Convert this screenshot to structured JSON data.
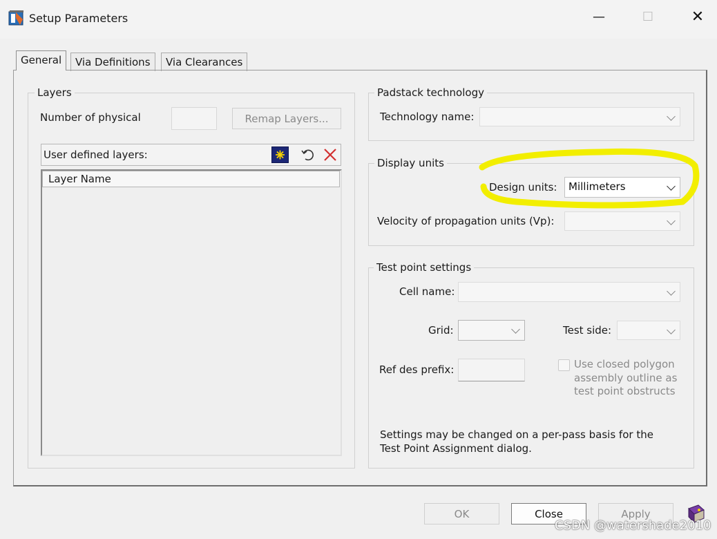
{
  "window": {
    "title": "Setup Parameters"
  },
  "tabs": [
    {
      "label": "General",
      "active": true
    },
    {
      "label": "Via Definitions",
      "active": false
    },
    {
      "label": "Via Clearances",
      "active": false
    }
  ],
  "layers": {
    "group_title": "Layers",
    "physical_label": "Number of physical",
    "physical_value": "",
    "remap_button": "Remap Layers...",
    "user_defined_label": "User defined layers:",
    "column_header": "Layer Name",
    "rows": []
  },
  "padstack": {
    "group_title": "Padstack technology",
    "tech_label": "Technology name:",
    "tech_value": ""
  },
  "display_units": {
    "group_title": "Display units",
    "design_label": "Design units:",
    "design_value": "Millimeters",
    "velocity_label": "Velocity of propagation units (Vp):",
    "velocity_value": ""
  },
  "test_point": {
    "group_title": "Test point settings",
    "cell_label": "Cell name:",
    "cell_value": "",
    "grid_label": "Grid:",
    "grid_value": "",
    "side_label": "Test side:",
    "side_value": "",
    "refdes_label": "Ref des prefix:",
    "refdes_value": "",
    "checkbox_label_1": "Use closed polygon",
    "checkbox_label_2": "assembly outline as",
    "checkbox_label_3": "test point obstructs",
    "checkbox_checked": false,
    "note_line_1": "Settings may be changed on a per-pass basis for the",
    "note_line_2": "Test Point Assignment dialog."
  },
  "footer": {
    "ok": "OK",
    "close": "Close",
    "apply": "Apply"
  },
  "icons": {
    "app": "app-icon",
    "minimize": "minimize-icon",
    "maximize": "maximize-icon",
    "close": "close-icon",
    "new_layer": "new-layer-icon",
    "undo": "undo-icon",
    "delete": "delete-icon",
    "help": "help-book-icon"
  },
  "colors": {
    "highlight": "#f2ee00",
    "new_layer_bg": "#1c2775",
    "delete": "#d23030"
  },
  "watermark": "CSDN @watershade2010"
}
